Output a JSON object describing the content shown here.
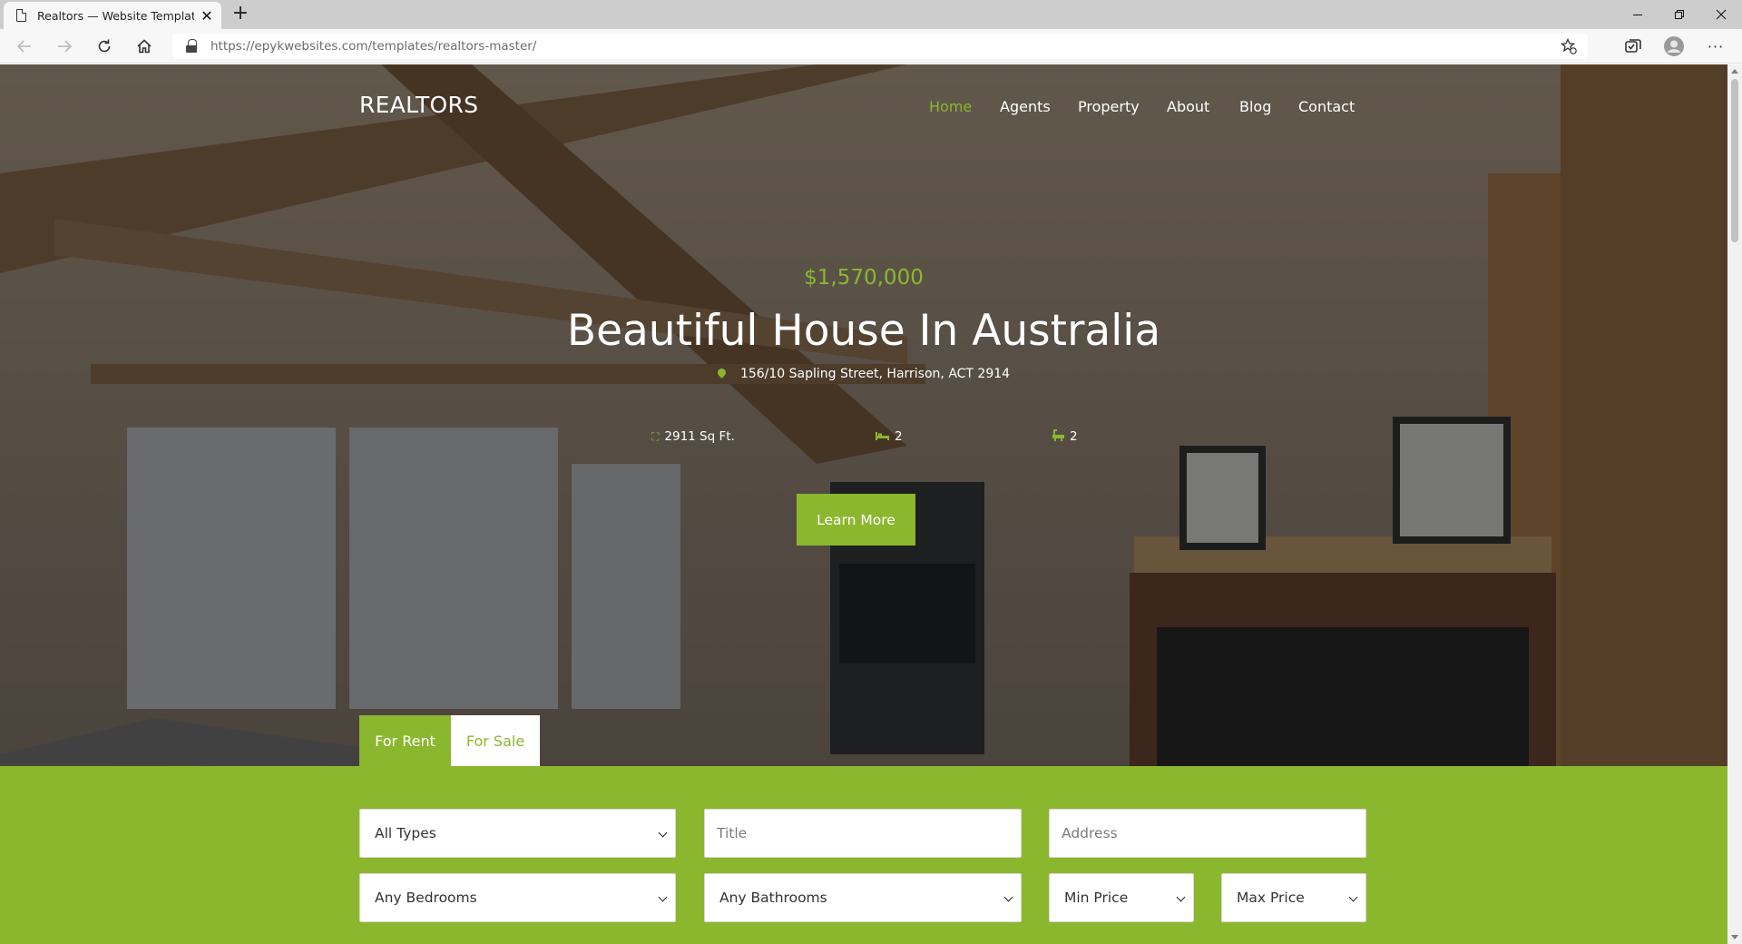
{
  "browser": {
    "tab_title": "Realtors — Website Template by",
    "url_host": "https://epykwebsites.com",
    "url_path": "/templates/realtors-master/"
  },
  "site": {
    "logo": "REALTORS",
    "nav": [
      "Home",
      "Agents",
      "Property",
      "About",
      "Blog",
      "Contact"
    ],
    "active_nav": "Home"
  },
  "hero": {
    "price": "$1,570,000",
    "title": "Beautiful House In Australia",
    "address": "156/10 Sapling Street, Harrison, ACT 2914",
    "features": {
      "area": "2911 Sq Ft.",
      "beds": "2",
      "baths": "2"
    },
    "cta": "Learn More"
  },
  "search": {
    "tabs": [
      "For Rent",
      "For Sale"
    ],
    "active_tab": "For Rent",
    "type_select": "All Types",
    "title_placeholder": "Title",
    "address_placeholder": "Address",
    "bedrooms_select": "Any Bedrooms",
    "bathrooms_select": "Any Bathrooms",
    "min_price_select": "Min Price",
    "max_price_select": "Max Price"
  },
  "colors": {
    "accent": "#8bb72f",
    "hero_overlay": "#121212"
  },
  "icons": [
    "page-icon",
    "close-icon",
    "new-tab-icon",
    "minimize-icon",
    "restore-icon",
    "window-close-icon",
    "back-arrow-icon",
    "forward-arrow-icon",
    "refresh-icon",
    "home-icon",
    "lock-icon",
    "favorites-icon",
    "collections-icon",
    "profile-icon",
    "more-icon",
    "map-pin-icon",
    "area-icon",
    "bed-icon",
    "bath-icon",
    "chevron-down-icon"
  ]
}
